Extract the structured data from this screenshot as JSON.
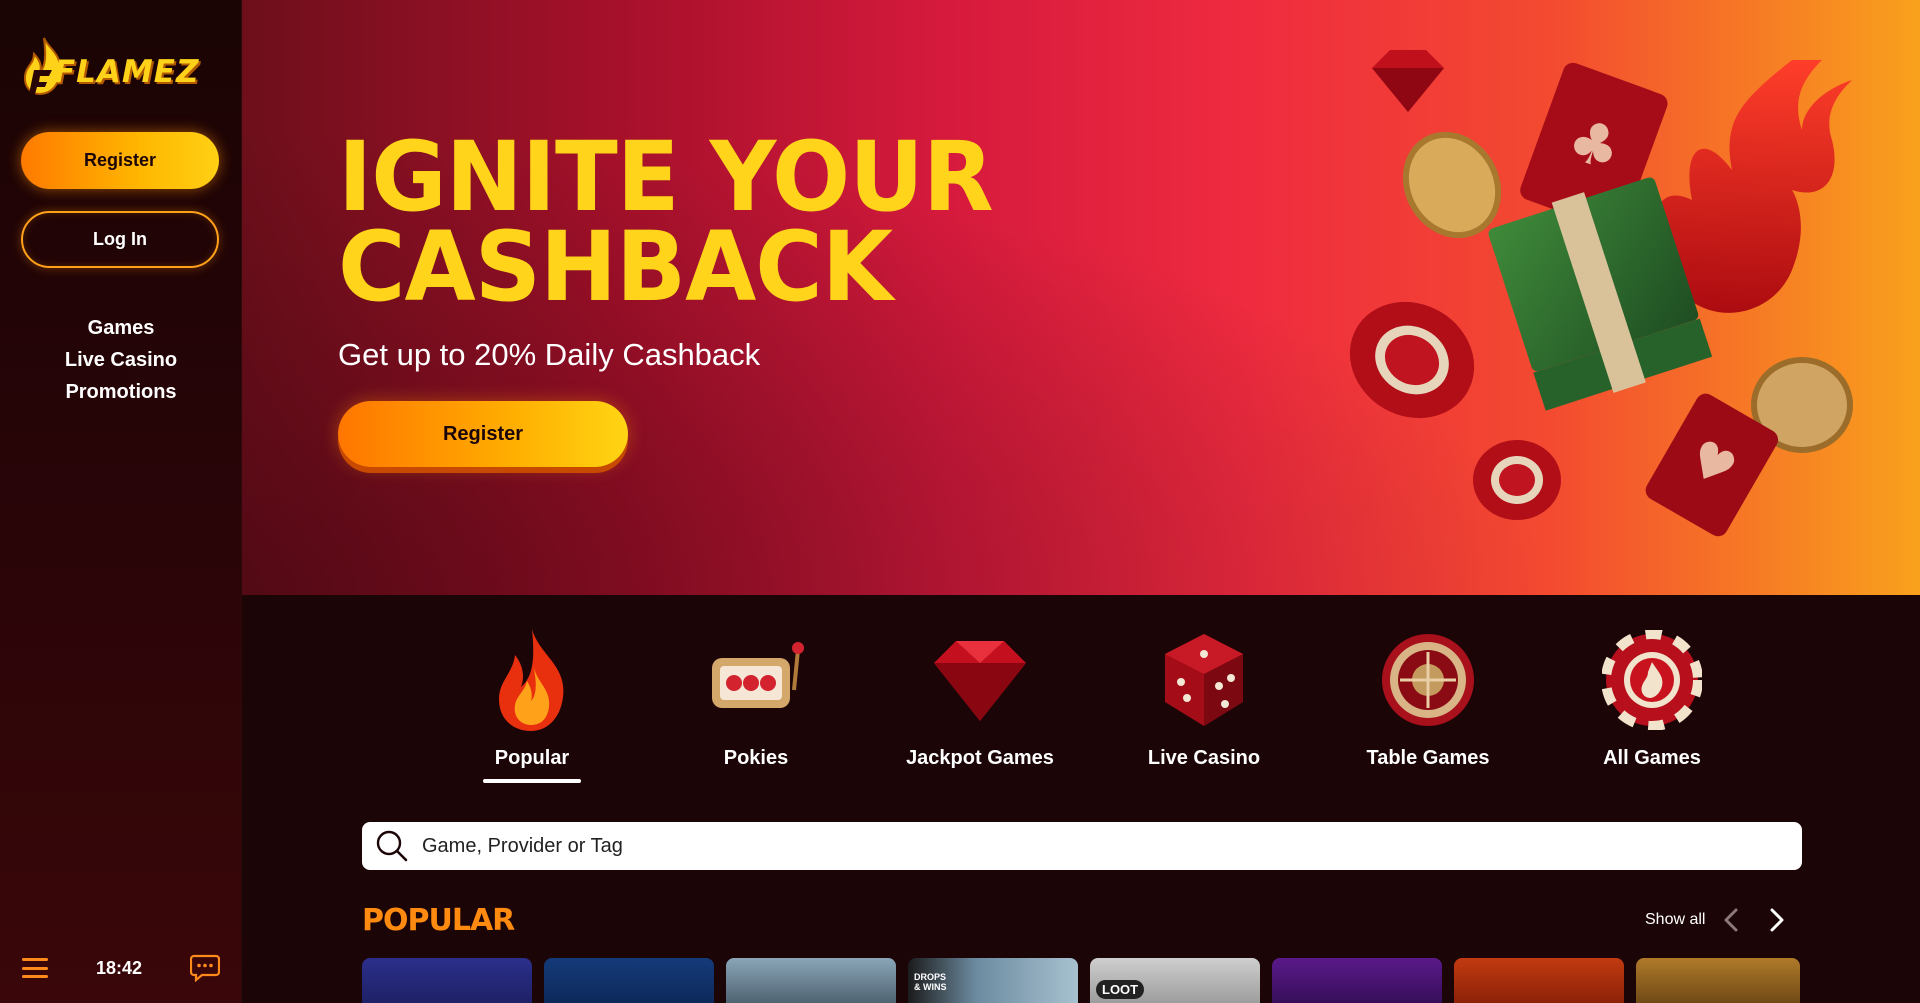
{
  "brand": {
    "name": "FLAMEZ"
  },
  "sidebar": {
    "register_label": "Register",
    "login_label": "Log In",
    "nav": [
      {
        "label": "Games"
      },
      {
        "label": "Live Casino"
      },
      {
        "label": "Promotions"
      }
    ],
    "clock": "18:42"
  },
  "hero": {
    "title_line1": "IGNITE YOUR",
    "title_line2": "CASHBACK",
    "subtitle": "Get up to 20% Daily Cashback",
    "cta_label": "Register"
  },
  "categories": [
    {
      "label": "Popular",
      "icon": "flame-icon",
      "active": true
    },
    {
      "label": "Pokies",
      "icon": "slot-machine-icon",
      "active": false
    },
    {
      "label": "Jackpot Games",
      "icon": "gem-icon",
      "active": false
    },
    {
      "label": "Live Casino",
      "icon": "dice-icon",
      "active": false
    },
    {
      "label": "Table Games",
      "icon": "roulette-icon",
      "active": false
    },
    {
      "label": "All Games",
      "icon": "chip-icon",
      "active": false
    }
  ],
  "search": {
    "placeholder": "Game, Provider or Tag"
  },
  "popular": {
    "title": "POPULAR",
    "show_all_label": "Show all",
    "tiles": [
      {
        "badge": ""
      },
      {
        "badge": ""
      },
      {
        "badge": ""
      },
      {
        "badge": "DROPS & WINS"
      },
      {
        "badge": "LOOT"
      },
      {
        "badge": ""
      },
      {
        "badge": ""
      },
      {
        "badge": ""
      }
    ]
  },
  "colors": {
    "accent_orange": "#ff8a10",
    "accent_yellow": "#ffd41a",
    "background": "#1c0507"
  }
}
